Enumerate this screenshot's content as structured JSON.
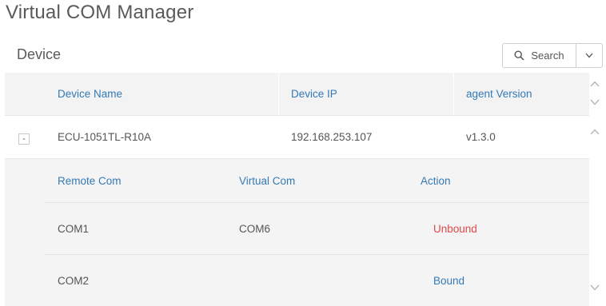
{
  "app": {
    "title": "Virtual COM Manager"
  },
  "section": {
    "title": "Device"
  },
  "toolbar": {
    "search_label": "Search"
  },
  "device_table": {
    "columns": [
      "Device Name",
      "Device IP",
      "agent Version"
    ],
    "rows": [
      {
        "expander": "-",
        "name": "ECU-1051TL-R10A",
        "ip": "192.168.253.107",
        "version": "v1.3.0",
        "ports": {
          "columns": [
            "Remote Com",
            "Virtual Com",
            "Action"
          ],
          "rows": [
            {
              "remote": "COM1",
              "virtual": "COM6",
              "action": "Unbound"
            },
            {
              "remote": "COM2",
              "virtual": "",
              "action": "Bound"
            }
          ]
        }
      }
    ]
  },
  "colors": {
    "link_blue": "#337ab7",
    "action_red": "#e04848",
    "header_bg": "#f3f3f3",
    "sub_bg": "#f4f4f4"
  }
}
